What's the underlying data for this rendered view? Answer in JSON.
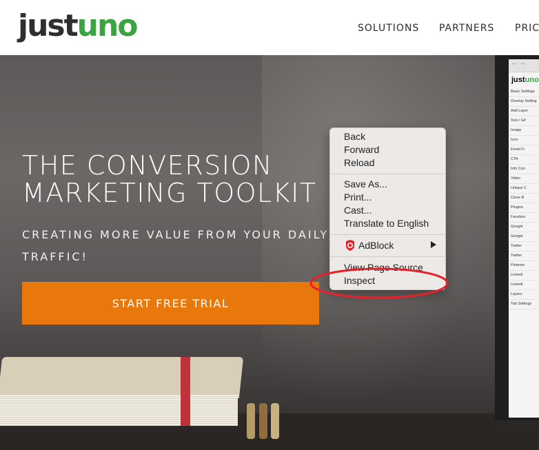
{
  "header": {
    "logo_part1": "just",
    "logo_part2": "uno",
    "nav": [
      "SOLUTIONS",
      "PARTNERS",
      "PRIC"
    ]
  },
  "hero": {
    "title_line1": "THE CONVERSION",
    "title_line2": "MARKETING TOOLKIT",
    "subtitle": "CREATING MORE VALUE FROM YOUR DAILY TRAFFIC!",
    "cta_label": "START FREE TRIAL"
  },
  "context_menu": {
    "group1": [
      "Back",
      "Forward",
      "Reload"
    ],
    "group2": [
      "Save As...",
      "Print...",
      "Cast...",
      "Translate to English"
    ],
    "extension": "AdBlock",
    "group3": [
      "View Page Source",
      "Inspect"
    ]
  },
  "laptop_screen": {
    "logo_part1": "just",
    "logo_part2": "uno",
    "rows": [
      "Basic Settings",
      "Overlay Setting",
      "Add Layer",
      "Text / Gif",
      "Image",
      "Icon",
      "Email Fi",
      "CTA",
      "Info Con",
      "Video",
      "Unique C",
      "Close B",
      "Plugins",
      "Faceboo",
      "Google",
      "Google",
      "Twitter",
      "Twitter",
      "Pinteres",
      "Linkedi",
      "Linkedi",
      "Layers",
      "Tab Settings"
    ]
  },
  "colors": {
    "brand_green": "#3aa540",
    "cta_orange": "#e9780c",
    "highlight_red": "#e5222a",
    "adblock_red": "#e5222a"
  }
}
